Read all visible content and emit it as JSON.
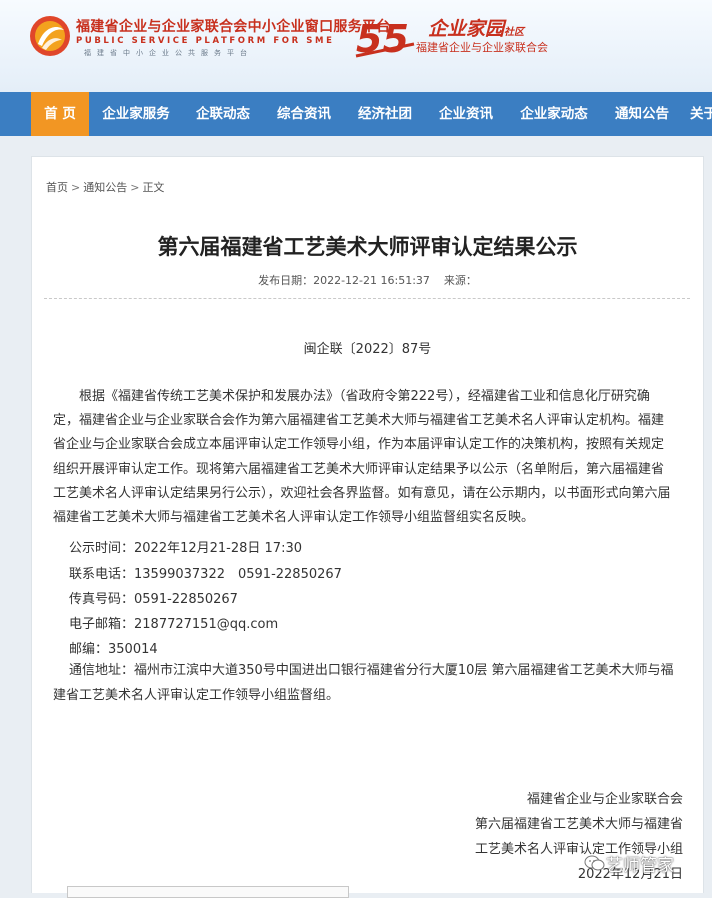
{
  "header": {
    "logo_cn": "福建省企业与企业家联合会中小企业窗口服务平台",
    "logo_en": "PUBLIC SERVICE PLATFORM FOR SME",
    "logo_sub": "福建省中小企业公共服务平台",
    "logo2_script": "企业家园",
    "logo2_script_small": "社区",
    "logo2_number": "55",
    "logo2_cn": "福建省企业与企业家联合会"
  },
  "nav": {
    "items": [
      {
        "label": "首 页",
        "active": true
      },
      {
        "label": "企业家服务"
      },
      {
        "label": "企联动态"
      },
      {
        "label": "综合资讯"
      },
      {
        "label": "经济社团"
      },
      {
        "label": "企业资讯"
      },
      {
        "label": "企业家动态"
      },
      {
        "label": "通知公告"
      },
      {
        "label": "关于"
      }
    ]
  },
  "breadcrumb": {
    "home": "首页",
    "section": "通知公告",
    "current": "正文",
    "separator": ">"
  },
  "article": {
    "title": "第六届福建省工艺美术大师评审认定结果公示",
    "publish_label": "发布日期：",
    "publish_date": "2022-12-21 16:51:37",
    "source_label": "来源：",
    "doc_number": "闽企联〔2022〕87号",
    "body": "根据《福建省传统工艺美术保护和发展办法》（省政府令第222号），经福建省工业和信息化厅研究确定，福建省企业与企业家联合会作为第六届福建省工艺美术大师与福建省工艺美术名人评审认定机构。福建省企业与企业家联合会成立本届评审认定工作领导小组，作为本届评审认定工作的决策机构，按照有关规定组织开展评审认定工作。现将第六届福建省工艺美术大师评审认定结果予以公示（名单附后，第六届福建省工艺美术名人评审认定结果另行公示），欢迎社会各界监督。如有意见，请在公示期内，以书面形式向第六届福建省工艺美术大师与福建省工艺美术名人评审认定工作领导小组监督组实名反映。",
    "contacts": {
      "period": "公示时间：2022年12月21-28日 17:30",
      "phone": "联系电话：13599037322　0591-22850267",
      "fax": "传真号码：0591-22850267",
      "email": "电子邮箱：2187727151@qq.com",
      "zip": "邮编：350014",
      "address": "通信地址：福州市江滨中大道350号中国进出口银行福建省分行大厦10层 第六届福建省工艺美术大师与福建省工艺美术名人评审认定工作领导小组监督组。"
    },
    "signature": {
      "org": "福建省企业与企业家联合会",
      "group_line1": "第六届福建省工艺美术大师与福建省",
      "group_line2": "工艺美术名人评审认定工作领导小组",
      "date": "2022年12月21日"
    }
  },
  "watermark": {
    "text": "艺师管家",
    "icon": "wechat-icon"
  },
  "colors": {
    "nav_bg": "#3b7ec2",
    "nav_active": "#f29623",
    "brand_red": "#c8301e"
  }
}
